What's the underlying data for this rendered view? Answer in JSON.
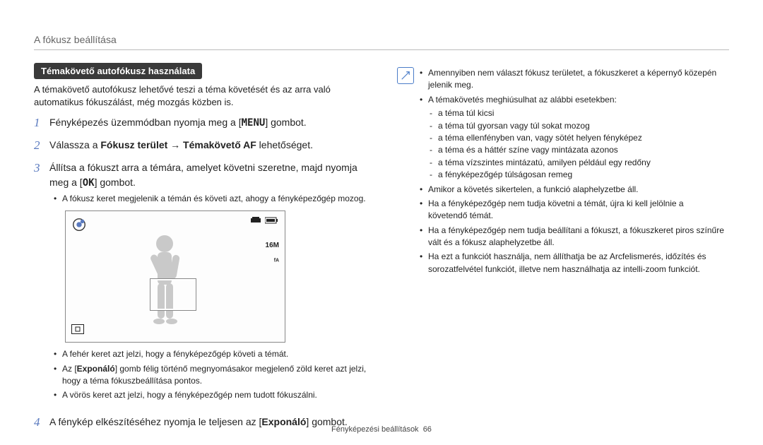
{
  "header": {
    "title": "A fókusz beállítása"
  },
  "left": {
    "section_title": "Témakövető autofókusz használata",
    "intro": "A témakövető autofókusz lehetővé teszi a téma követését és az arra való automatikus fókuszálást, még mozgás közben is.",
    "steps": [
      {
        "num": "1",
        "pre": "Fényképezés üzemmódban nyomja meg a [",
        "key": "MENU",
        "post": "] gombot."
      },
      {
        "num": "2",
        "pre": "Válassza a ",
        "bold": "Fókusz terület → Témakövető AF",
        "post": " lehetőséget."
      },
      {
        "num": "3",
        "pre": "Állítsa a fókuszt arra a témára, amelyet követni szeretne, majd nyomja meg a [",
        "key": "OK",
        "post": "] gombot.",
        "subbullets": [
          "A fókusz keret megjelenik a témán és követi azt, ahogy a fényképezőgép mozog."
        ],
        "screenshot": true,
        "screenshot_overlays": {
          "res": "16M",
          "flash": "ᶠᴬ"
        },
        "afterbullets": [
          "A fehér keret azt jelzi, hogy a fényképezőgép követi a témát.",
          "Az [__B__Exponáló__B__] gomb félig történő megnyomásakor megjelenő zöld keret azt jelzi, hogy a téma fókuszbeállítása pontos.",
          "A vörös keret azt jelzi, hogy a fényképezőgép nem tudott fókuszálni."
        ]
      },
      {
        "num": "4",
        "pre": "A fénykép elkészítéséhez nyomja le teljesen az [",
        "bold": "Exponáló",
        "post": "] gombot."
      }
    ]
  },
  "right": {
    "notes": [
      {
        "text": "Amennyiben nem választ fókusz területet, a fókuszkeret a képernyő közepén jelenik meg."
      },
      {
        "text": "A témakövetés meghiúsulhat az alábbi esetekben:",
        "dashes": [
          "a téma túl kicsi",
          "a téma túl gyorsan vagy túl sokat mozog",
          "a téma ellenfényben van, vagy sötét helyen fényképez",
          "a téma és a háttér színe vagy mintázata azonos",
          "a téma vízszintes mintázatú, amilyen például egy redőny",
          "a fényképezőgép túlságosan remeg"
        ]
      },
      {
        "text": "Amikor a követés sikertelen, a funkció alaphelyzetbe áll."
      },
      {
        "text": "Ha a fényképezőgép nem tudja követni a témát, újra ki kell jelölnie a követendő témát."
      },
      {
        "text": "Ha a fényképezőgép nem tudja beállítani a fókuszt, a fókuszkeret piros színűre vált és a fókusz alaphelyzetbe áll."
      },
      {
        "text": "Ha ezt a funkciót használja, nem állíthatja be az Arcfelismerés, időzítés és sorozatfelvétel funkciót, illetve nem használhatja az intelli-zoom funkciót."
      }
    ]
  },
  "footer": {
    "section": "Fényképezési beállítások",
    "page": "66"
  }
}
